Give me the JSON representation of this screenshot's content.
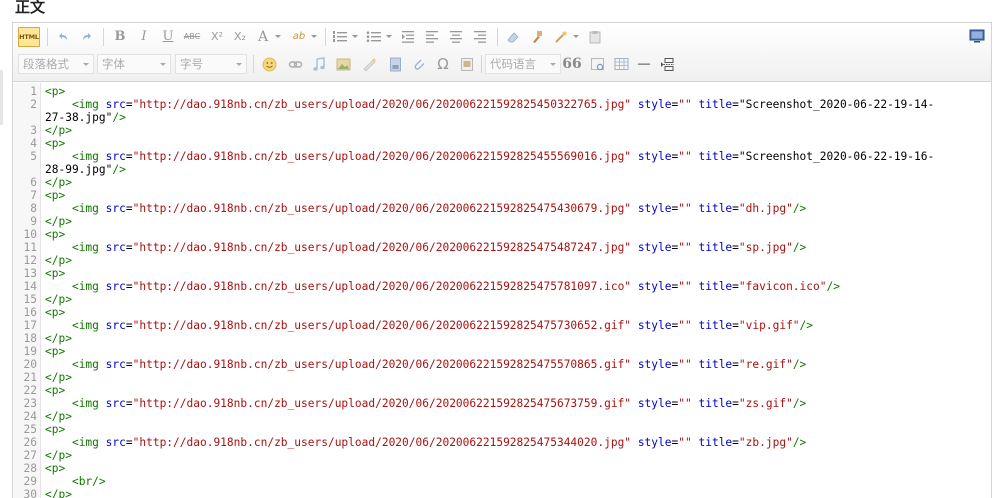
{
  "page_title": "正文",
  "toolbar": {
    "html_label": "HTML",
    "bold_label": "B",
    "italic_label": "I",
    "underline_label": "U",
    "strike_label": "ABC",
    "superscript_label": "X²",
    "subscript_label": "X₂",
    "fontcolor_label": "A",
    "highlight_label": "ab",
    "paragraph_select": "段落格式",
    "font_select": "字体",
    "size_select": "字号",
    "omega_label": "Ω",
    "code_lang_select": "代码语言",
    "quote_label": "66"
  },
  "code": {
    "lines": [
      {
        "n": "1",
        "text": "<p>"
      },
      {
        "n": "2",
        "text": "    <img src=\"http://dao.918nb.cn/zb_users/upload/2020/06/202006221592825450322765.jpg\" style=\"\" title=\"Screenshot_2020-06-22-19-14-"
      },
      {
        "n": "",
        "text": "27-38.jpg\"/>"
      },
      {
        "n": "3",
        "text": "</p>"
      },
      {
        "n": "4",
        "text": "<p>"
      },
      {
        "n": "5",
        "text": "    <img src=\"http://dao.918nb.cn/zb_users/upload/2020/06/202006221592825455569016.jpg\" style=\"\" title=\"Screenshot_2020-06-22-19-16-"
      },
      {
        "n": "",
        "text": "28-99.jpg\"/>"
      },
      {
        "n": "6",
        "text": "</p>"
      },
      {
        "n": "7",
        "text": "<p>"
      },
      {
        "n": "8",
        "text": "    <img src=\"http://dao.918nb.cn/zb_users/upload/2020/06/202006221592825475430679.jpg\" style=\"\" title=\"dh.jpg\"/>"
      },
      {
        "n": "9",
        "text": "</p>"
      },
      {
        "n": "10",
        "text": "<p>"
      },
      {
        "n": "11",
        "text": "    <img src=\"http://dao.918nb.cn/zb_users/upload/2020/06/202006221592825475487247.jpg\" style=\"\" title=\"sp.jpg\"/>"
      },
      {
        "n": "12",
        "text": "</p>"
      },
      {
        "n": "13",
        "text": "<p>"
      },
      {
        "n": "14",
        "text": "    <img src=\"http://dao.918nb.cn/zb_users/upload/2020/06/202006221592825475781097.ico\" style=\"\" title=\"favicon.ico\"/>"
      },
      {
        "n": "15",
        "text": "</p>"
      },
      {
        "n": "16",
        "text": "<p>"
      },
      {
        "n": "17",
        "text": "    <img src=\"http://dao.918nb.cn/zb_users/upload/2020/06/202006221592825475730652.gif\" style=\"\" title=\"vip.gif\"/>"
      },
      {
        "n": "18",
        "text": "</p>"
      },
      {
        "n": "19",
        "text": "<p>"
      },
      {
        "n": "20",
        "text": "    <img src=\"http://dao.918nb.cn/zb_users/upload/2020/06/202006221592825475570865.gif\" style=\"\" title=\"re.gif\"/>"
      },
      {
        "n": "21",
        "text": "</p>"
      },
      {
        "n": "22",
        "text": "<p>"
      },
      {
        "n": "23",
        "text": "    <img src=\"http://dao.918nb.cn/zb_users/upload/2020/06/202006221592825475673759.gif\" style=\"\" title=\"zs.gif\"/>"
      },
      {
        "n": "24",
        "text": "</p>"
      },
      {
        "n": "25",
        "text": "<p>"
      },
      {
        "n": "26",
        "text": "    <img src=\"http://dao.918nb.cn/zb_users/upload/2020/06/202006221592825475344020.jpg\" style=\"\" title=\"zb.jpg\"/>"
      },
      {
        "n": "27",
        "text": "</p>"
      },
      {
        "n": "28",
        "text": "<p>"
      },
      {
        "n": "29",
        "text": "    <br/>"
      },
      {
        "n": "30",
        "text": "</p>"
      }
    ]
  }
}
